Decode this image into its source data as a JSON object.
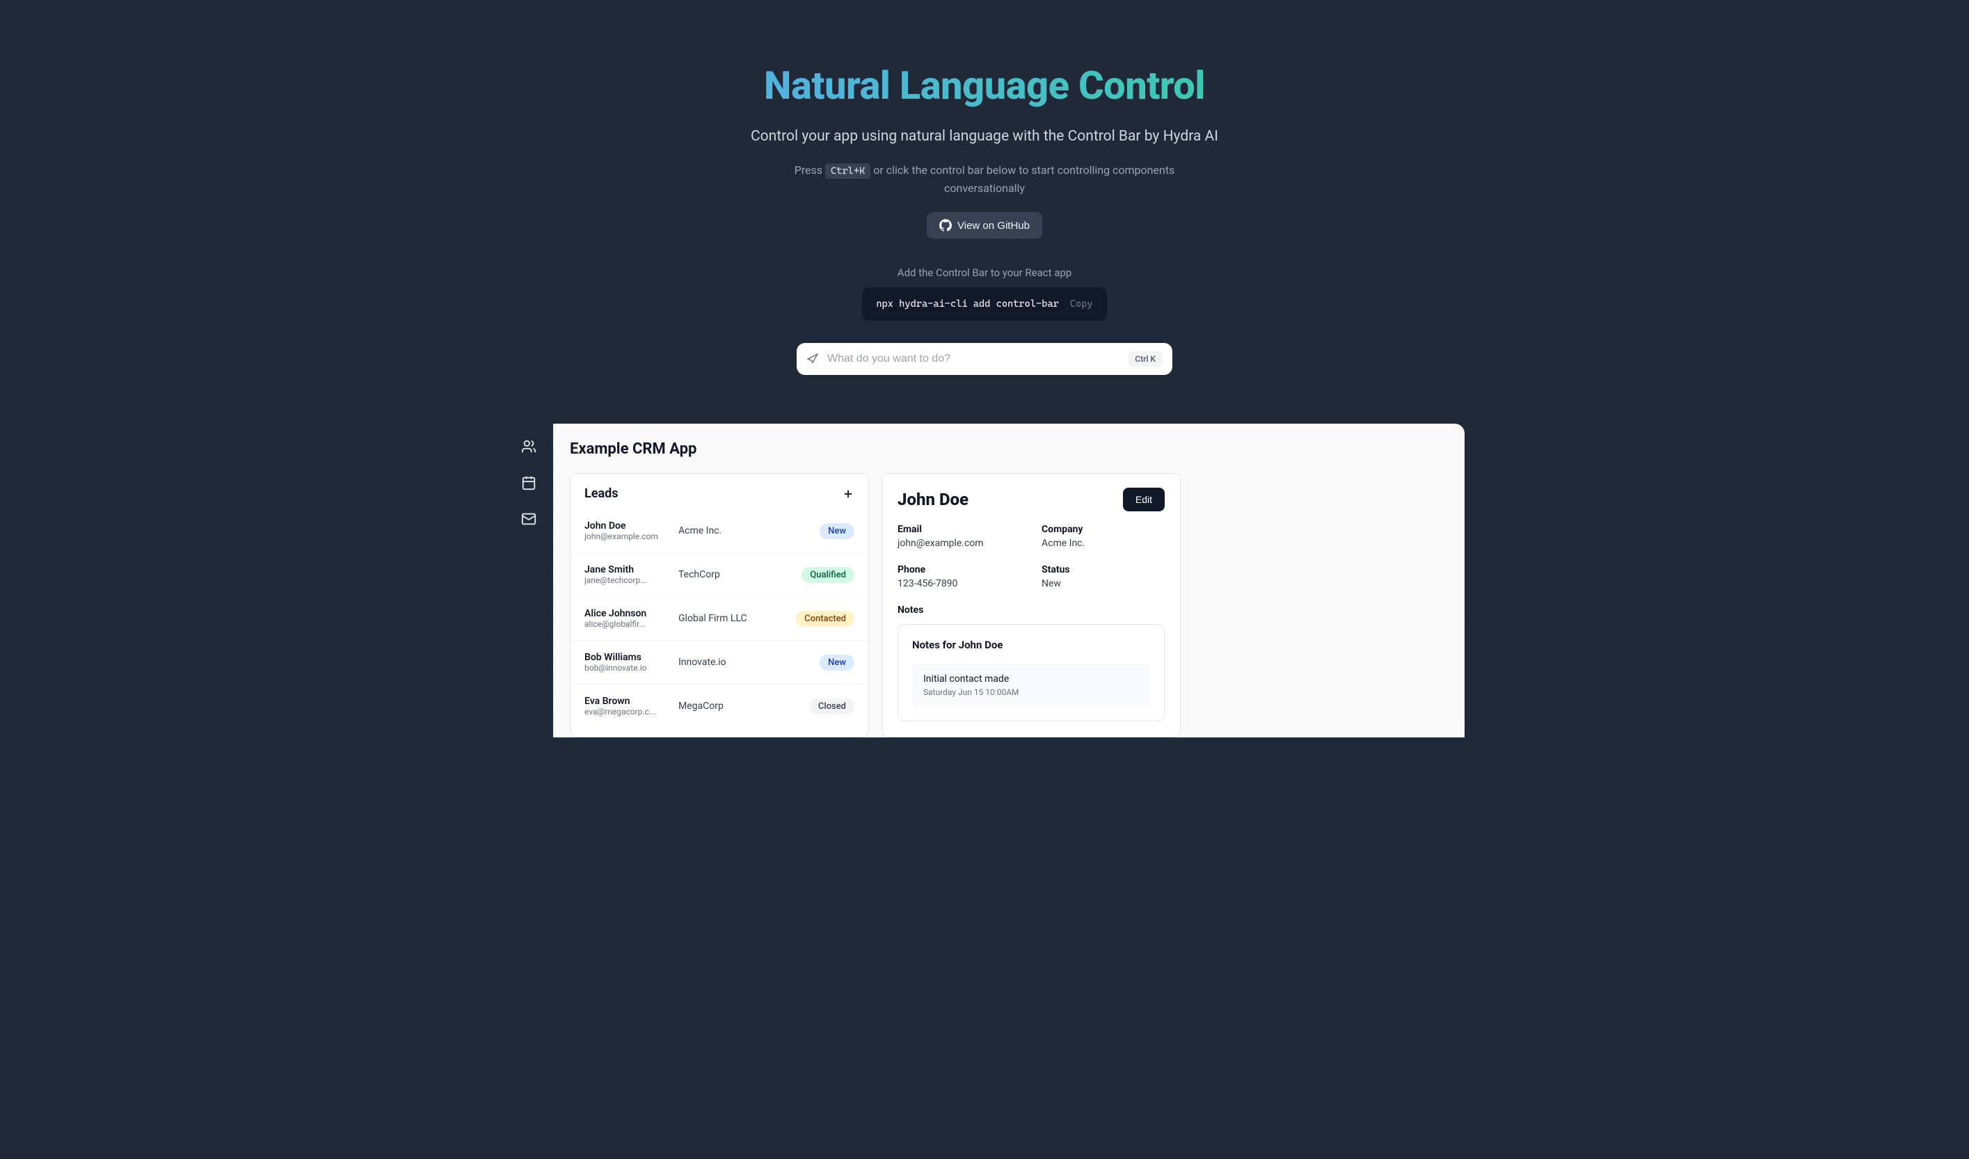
{
  "hero": {
    "title": "Natural Language Control",
    "subtitle": "Control your app using natural language with the Control Bar by Hydra AI",
    "instructions_pre": "Press ",
    "instructions_kbd": "Ctrl+K",
    "instructions_post": " or click the control bar below to start controlling components conversationally",
    "github_label": "View on GitHub",
    "cli_label": "Add the Control Bar to your React app",
    "cli_command": "npx hydra-ai-cli add control-bar",
    "copy_label": "Copy"
  },
  "control_bar": {
    "placeholder": "What do you want to do?",
    "shortcut": "Ctrl K"
  },
  "app": {
    "title": "Example CRM App",
    "leads_panel_title": "Leads",
    "leads": [
      {
        "name": "John Doe",
        "email": "john@example.com",
        "company": "Acme Inc.",
        "status": "New",
        "status_class": "status-new"
      },
      {
        "name": "Jane Smith",
        "email": "jane@techcorp...",
        "company": "TechCorp",
        "status": "Qualified",
        "status_class": "status-qualified"
      },
      {
        "name": "Alice Johnson",
        "email": "alice@globalfir...",
        "company": "Global Firm LLC",
        "status": "Contacted",
        "status_class": "status-contacted"
      },
      {
        "name": "Bob Williams",
        "email": "bob@innovate.io",
        "company": "Innovate.io",
        "status": "New",
        "status_class": "status-new"
      },
      {
        "name": "Eva Brown",
        "email": "eva@megacorp.c...",
        "company": "MegaCorp",
        "status": "Closed",
        "status_class": "status-closed"
      }
    ],
    "detail": {
      "name": "John Doe",
      "edit_label": "Edit",
      "fields": {
        "email_label": "Email",
        "email_value": "john@example.com",
        "company_label": "Company",
        "company_value": "Acme Inc.",
        "phone_label": "Phone",
        "phone_value": "123-456-7890",
        "status_label": "Status",
        "status_value": "New"
      },
      "notes_label": "Notes",
      "notes_title": "Notes for John Doe",
      "notes": [
        {
          "text": "Initial contact made",
          "time": "Saturday Jun 15 10:00AM"
        }
      ]
    }
  }
}
